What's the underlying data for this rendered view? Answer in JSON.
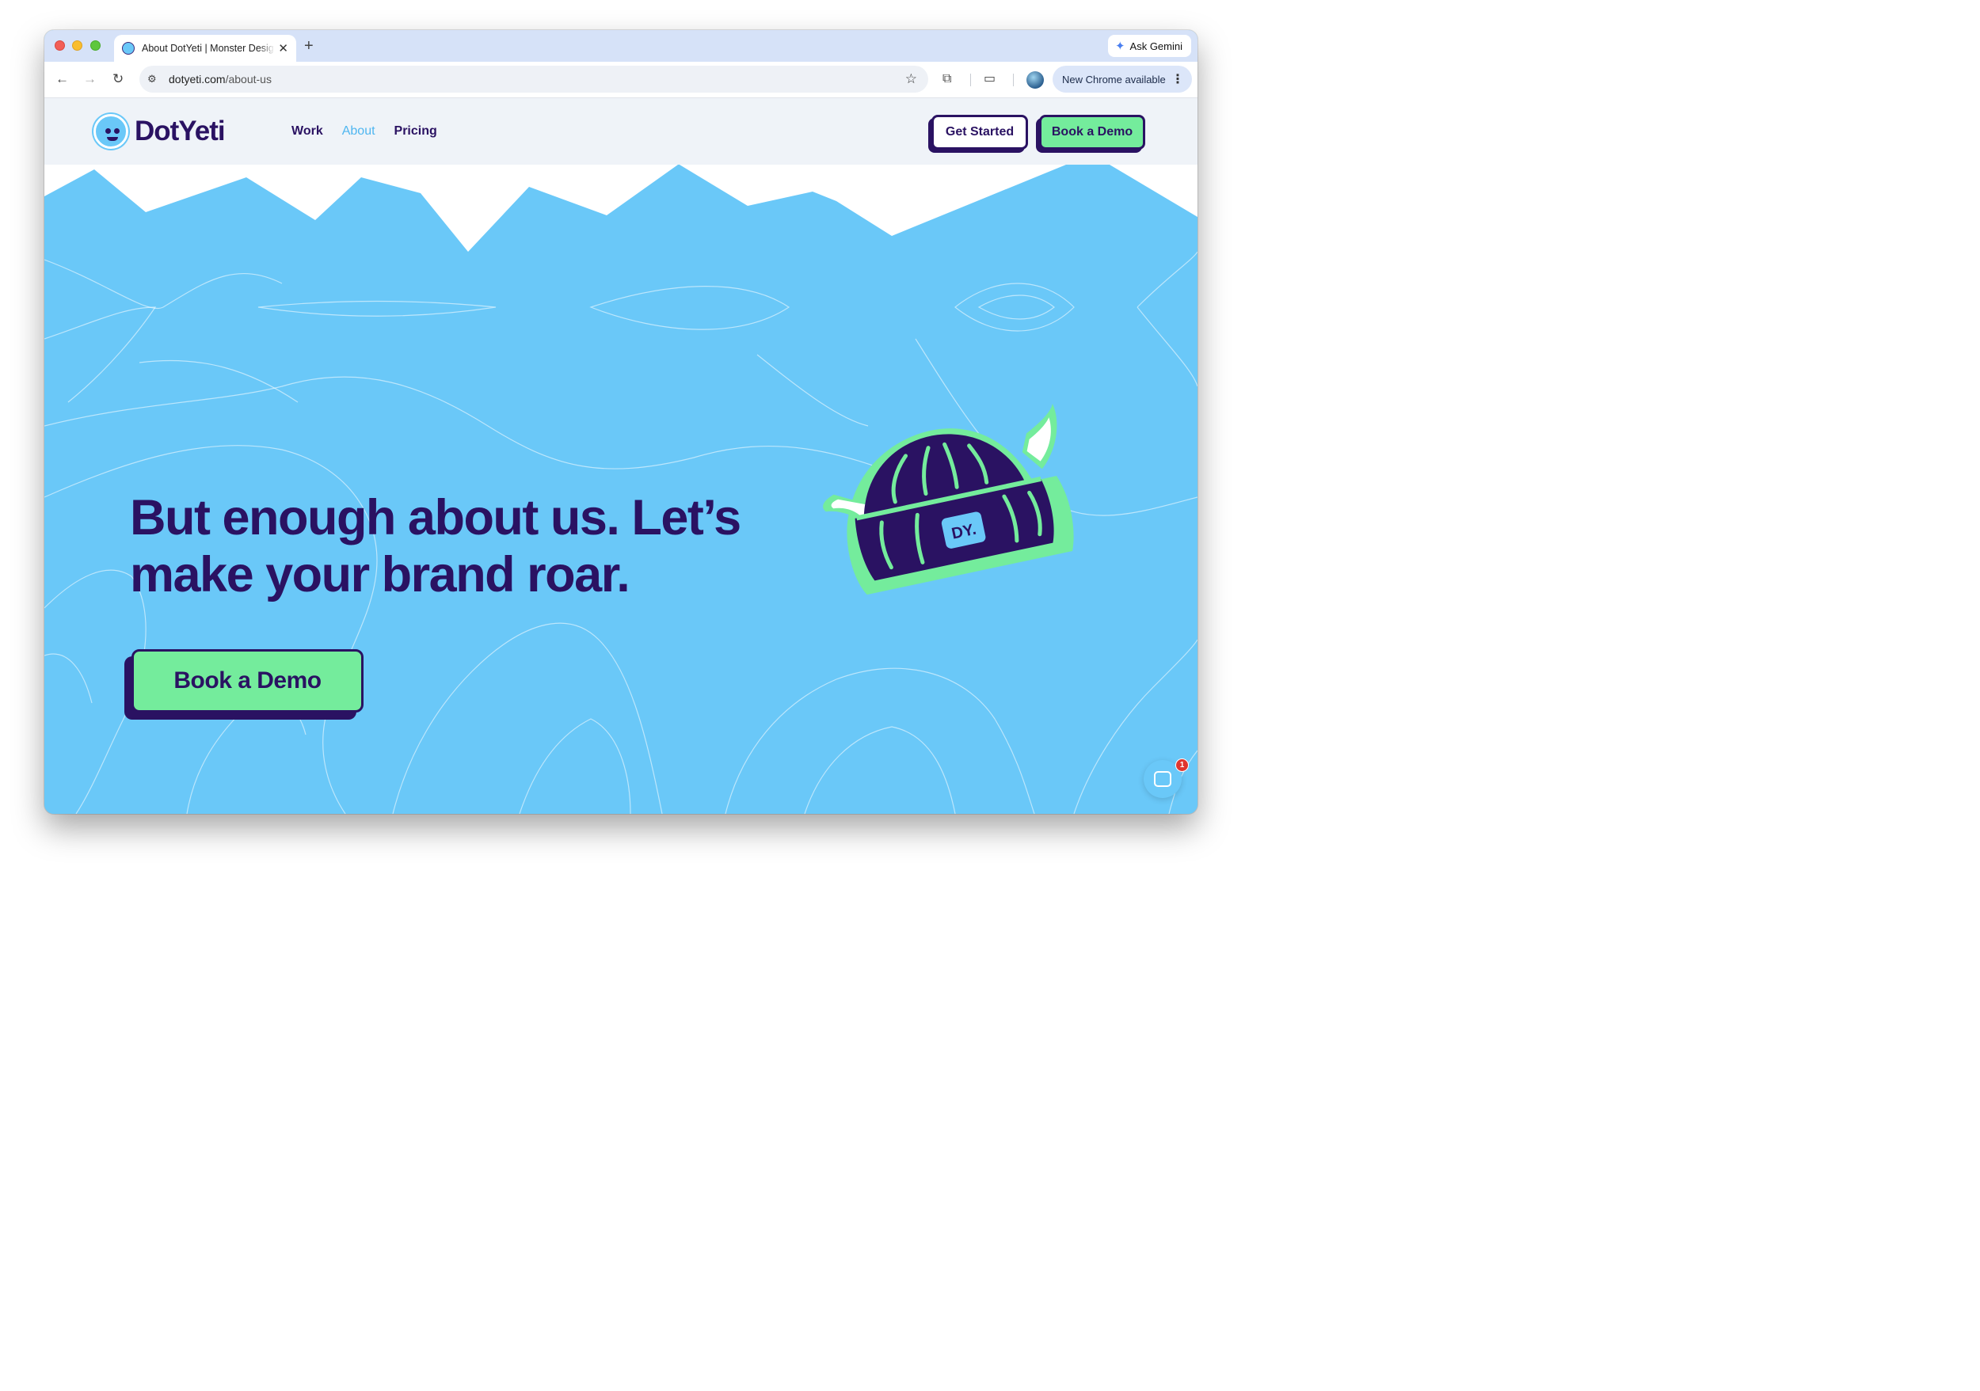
{
  "browser": {
    "tab_title": "About DotYeti | Monster Design",
    "tab_close": "✕",
    "new_tab": "+",
    "gemini_label": "Ask Gemini",
    "url_host": "dotyeti.com",
    "url_path": "/about-us",
    "update_label": "New Chrome available",
    "icons": {
      "back": "←",
      "forward": "→",
      "reload": "↻",
      "tune": "⚙",
      "star": "☆",
      "extensions": "⧉",
      "cast": "▭",
      "menu": "⋮",
      "gemini": "✦"
    }
  },
  "site": {
    "brand": "DotYeti",
    "nav": [
      {
        "label": "Work"
      },
      {
        "label": "About"
      },
      {
        "label": "Pricing"
      }
    ],
    "header_buttons": {
      "get_started": "Get Started",
      "book_demo": "Book a Demo"
    },
    "hero": {
      "headline": "But enough about us. Let’s make your brand roar.",
      "cta": "Book a Demo",
      "beanie_badge": "DY."
    },
    "chat": {
      "unread_count": "1"
    },
    "colors": {
      "navy": "#2a1262",
      "sky": "#6ac8f8",
      "mint": "#74ec9c",
      "header_bg": "#eff3f8"
    }
  }
}
